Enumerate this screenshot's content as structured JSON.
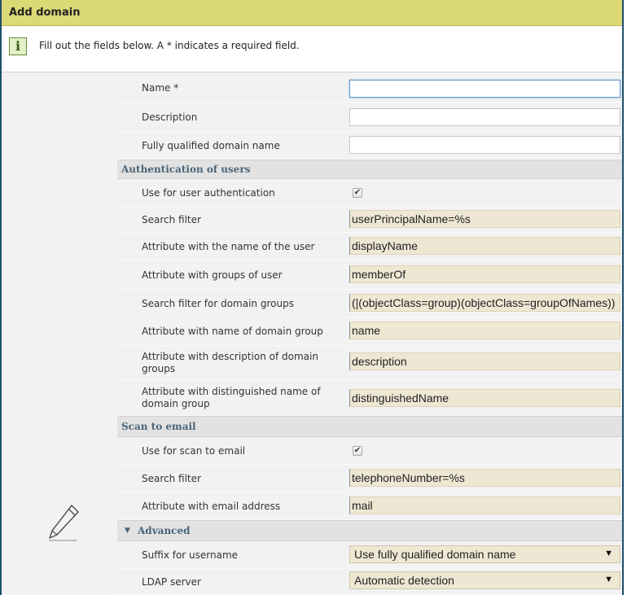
{
  "dialog": {
    "title": "Add domain",
    "info_text": "Fill out the fields below. A * indicates a required field."
  },
  "fields": {
    "name_label": "Name *",
    "name_value": "",
    "description_label": "Description",
    "description_value": "",
    "fqdn_label": "Fully qualified domain name",
    "fqdn_value": ""
  },
  "auth": {
    "section_title": "Authentication of users",
    "use_auth_label": "Use for user authentication",
    "use_auth_checked": "✔",
    "search_filter_label": "Search filter",
    "search_filter_value": "userPrincipalName=%s",
    "user_name_attr_label": "Attribute with the name of the user",
    "user_name_attr_value": "displayName",
    "groups_attr_label": "Attribute with groups of user",
    "groups_attr_value": "memberOf",
    "group_filter_label": "Search filter for domain groups",
    "group_filter_value": "(|(objectClass=group)(objectClass=groupOfNames))",
    "group_name_attr_label": "Attribute with name of domain group",
    "group_name_attr_value": "name",
    "group_desc_attr_label": "Attribute with description of domain groups",
    "group_desc_attr_value": "description",
    "group_dn_attr_label": "Attribute with distinguished name of domain group",
    "group_dn_attr_value": "distinguishedName"
  },
  "scan": {
    "section_title": "Scan to email",
    "use_scan_label": "Use for scan to email",
    "use_scan_checked": "✔",
    "search_filter_label": "Search filter",
    "search_filter_value": "telephoneNumber=%s",
    "email_attr_label": "Attribute with email address",
    "email_attr_value": "mail"
  },
  "advanced": {
    "section_title": "Advanced",
    "toggle_icon": "▼",
    "suffix_label": "Suffix for username",
    "suffix_value": "Use fully qualified domain name",
    "ldap_label": "LDAP server",
    "ldap_value": "Automatic detection",
    "dropdown_icon": "▼"
  },
  "icons": {
    "info": "i",
    "edit": "pencil-icon"
  },
  "colors": {
    "titlebar": "#dcd977",
    "section_text": "#4a6478",
    "readonly_field": "#eee7d3",
    "frame_border": "#1f4f6a"
  }
}
